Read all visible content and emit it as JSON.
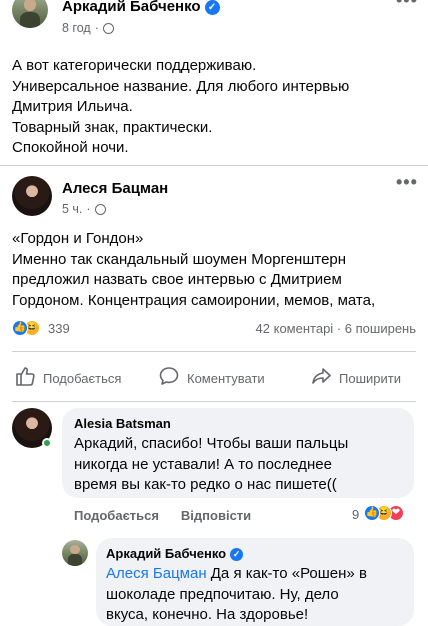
{
  "post1": {
    "author": "Аркадий Бабченко",
    "time": "8 год",
    "text": "А вот категорически поддерживаю.\nУниверсальное название. Для любого интервью\nДмитрия Ильича.\nТоварный знак, практически.\nСпокойной ночи."
  },
  "post2": {
    "author": "Алеся Бацман",
    "time": "5 ч.",
    "text": "«Гордон и Гондон»\nИменно так скандальный шоумен Моргенштерн\nпредложил назвать свое интервью с Дмитрием\nГордоном. Концентрация самоиронии, мемов, мата,"
  },
  "stats": {
    "reactions_count": "339",
    "comments": "42 коментарі",
    "shares": "6 поширень",
    "separator": "·"
  },
  "actions": {
    "like": "Подобається",
    "comment": "Коментувати",
    "share": "Поширити"
  },
  "comment1": {
    "author": "Alesia Batsman",
    "text": "Аркадий, спасибо! Чтобы ваши пальцы\nникогда не уставали! А то последнее\nвремя вы как-то редко о нас пишете((",
    "like": "Подобається",
    "reply": "Відповісти",
    "reaction_count": "9"
  },
  "reply1": {
    "author": "Аркадий Бабченко",
    "mention": "Алеся Бацман",
    "text_line1": " Да я как-то «Рошен» в",
    "text_rest": "шоколаде предпочитаю. Ну, дело\nвкуса, конечно. На здоровье!"
  },
  "icons": {
    "verified": "✓",
    "more": "•••",
    "like": "👍",
    "comment": "💬",
    "share": "➦",
    "haha": "😆",
    "love": "❤",
    "wow": "😮"
  },
  "colors": {
    "accent": "#1877f2",
    "secondary_text": "#65676b",
    "bubble": "#f0f2f5",
    "online": "#31a24c"
  }
}
